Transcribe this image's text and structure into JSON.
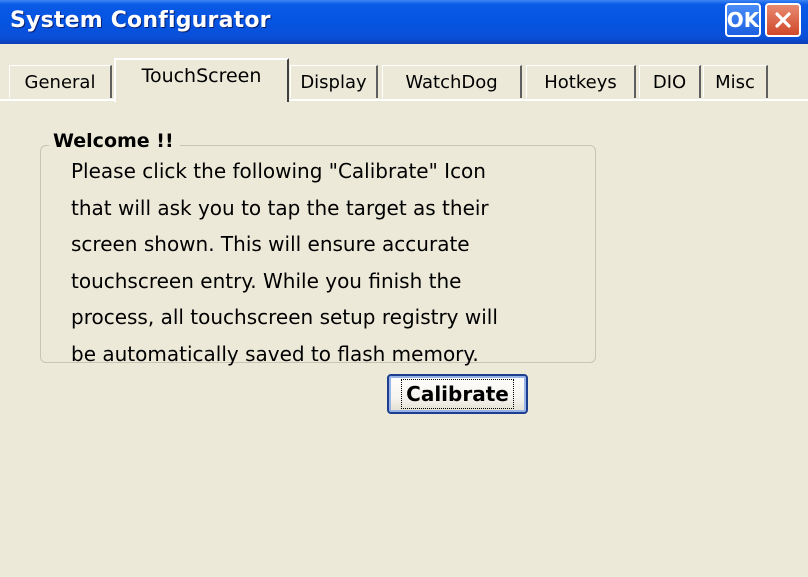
{
  "window": {
    "title": "System Configurator",
    "ok_label": "OK"
  },
  "tabs": [
    {
      "label": "General",
      "active": false
    },
    {
      "label": "TouchScreen",
      "active": true
    },
    {
      "label": "Display",
      "active": false
    },
    {
      "label": "WatchDog",
      "active": false
    },
    {
      "label": "Hotkeys",
      "active": false
    },
    {
      "label": "DIO",
      "active": false
    },
    {
      "label": "Misc",
      "active": false
    }
  ],
  "group": {
    "title": "Welcome !!",
    "lines": [
      "Please click the following \"Calibrate\" Icon",
      "that will ask you to tap the target as their",
      "screen shown. This will ensure accurate",
      "touchscreen entry. While you finish the",
      "process, all touchscreen setup registry will",
      "be automatically saved to flash memory."
    ]
  },
  "calibrate_label": "Calibrate",
  "icons": {
    "close": "close-icon"
  },
  "colors": {
    "titlebar": "#0554e2",
    "close_button": "#d0482a",
    "dialog_background": "#ece9d8",
    "focus_border": "#1d3d8e"
  }
}
